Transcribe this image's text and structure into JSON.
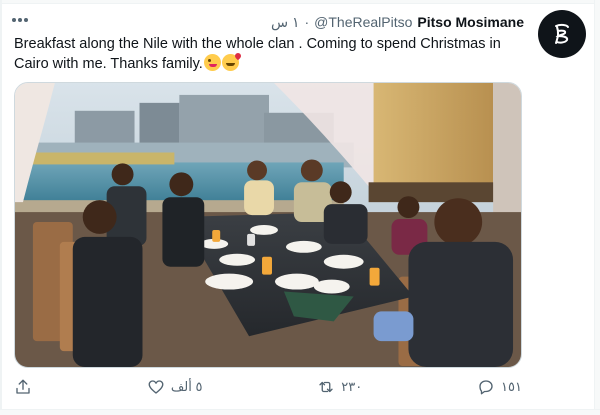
{
  "tweet": {
    "display_name": "Pitso Mosimane",
    "handle": "@TheRealPitso",
    "separator": "·",
    "time": "١ س",
    "text": "Breakfast along the Nile with the whole clan . Coming to spend Christmas in Cairo with me. Thanks family.",
    "emojis": [
      "winking-face-with-tongue",
      "smiling-face-with-hearts"
    ]
  },
  "actions": {
    "likes": "٥ ألف",
    "retweets": "٢٣٠",
    "replies": "١٥١"
  },
  "colors": {
    "text": "#0f1419",
    "secondary": "#536471",
    "border": "#cfd9de",
    "avatar_bg": "#0f1419"
  }
}
